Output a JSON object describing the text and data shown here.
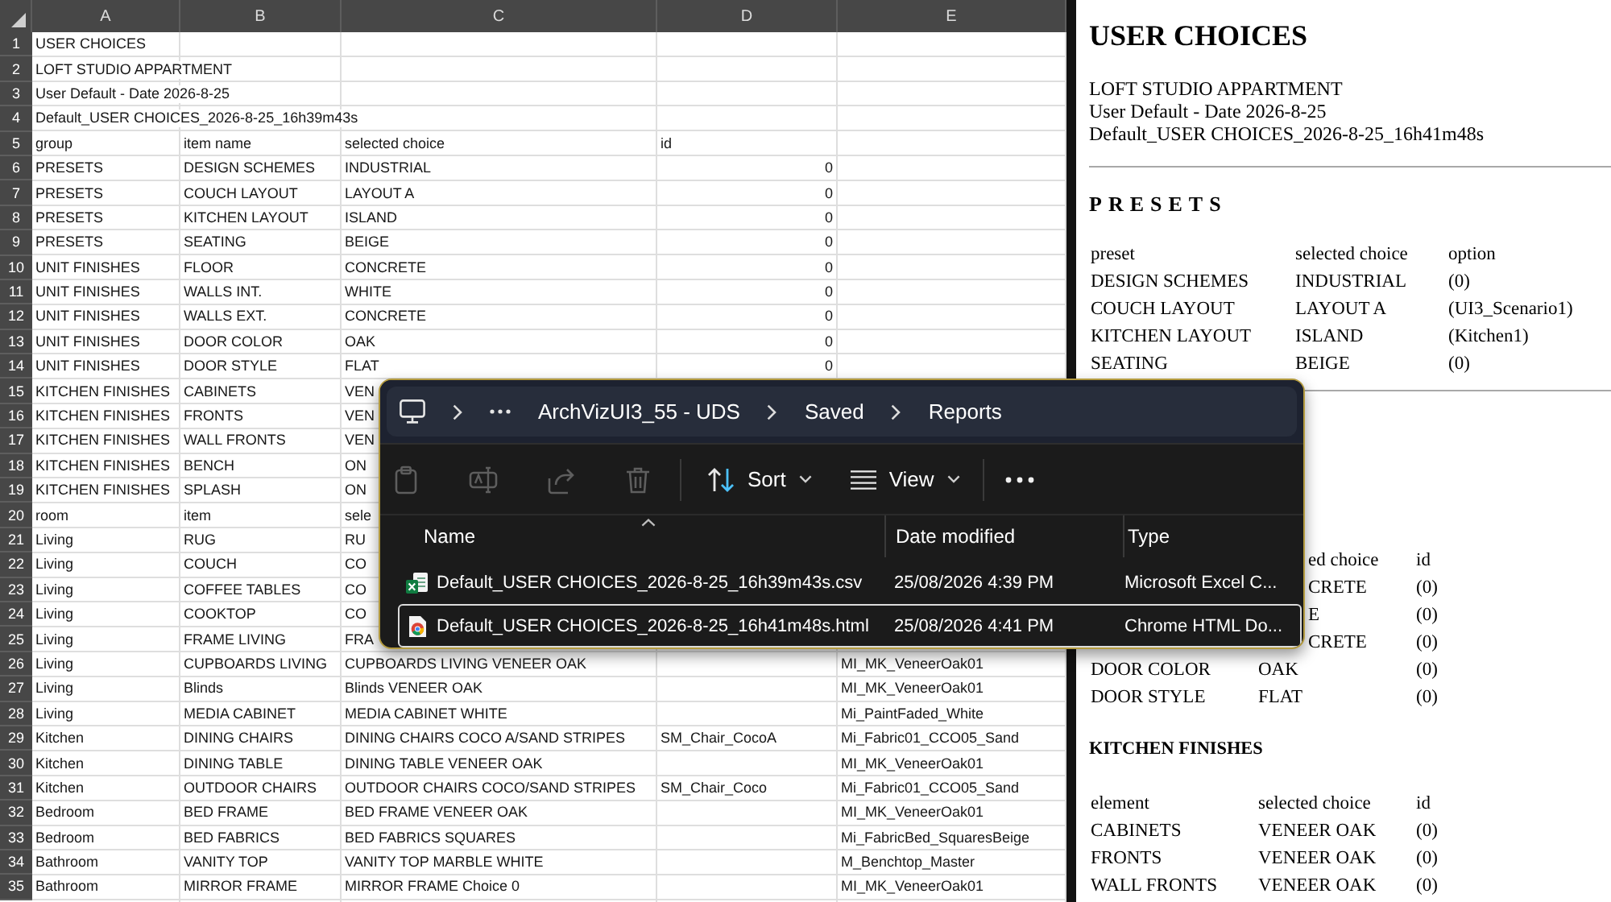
{
  "spreadsheet": {
    "columns": [
      "A",
      "B",
      "C",
      "D",
      "E"
    ],
    "rows": [
      {
        "number": "1",
        "cells": {
          "A": "USER CHOICES"
        }
      },
      {
        "number": "2",
        "cells": {
          "A": "LOFT STUDIO APPARTMENT"
        }
      },
      {
        "number": "3",
        "cells": {
          "A": "User Default - Date 2026-8-25"
        }
      },
      {
        "number": "4",
        "cells": {
          "A": "Default_USER CHOICES_2026-8-25_16h39m43s"
        }
      },
      {
        "number": "5",
        "cells": {
          "A": "group",
          "B": "item name",
          "C": "selected choice",
          "D": "id"
        }
      },
      {
        "number": "6",
        "cells": {
          "A": "PRESETS",
          "B": "DESIGN SCHEMES",
          "C": "INDUSTRIAL"
        },
        "numbers": {
          "D": "0"
        }
      },
      {
        "number": "7",
        "cells": {
          "A": "PRESETS",
          "B": "COUCH LAYOUT",
          "C": "LAYOUT A"
        },
        "numbers": {
          "D": "0"
        }
      },
      {
        "number": "8",
        "cells": {
          "A": "PRESETS",
          "B": "KITCHEN LAYOUT",
          "C": "ISLAND"
        },
        "numbers": {
          "D": "0"
        }
      },
      {
        "number": "9",
        "cells": {
          "A": "PRESETS",
          "B": "SEATING",
          "C": "BEIGE"
        },
        "numbers": {
          "D": "0"
        }
      },
      {
        "number": "10",
        "cells": {
          "A": "UNIT FINISHES",
          "B": "FLOOR",
          "C": "CONCRETE"
        },
        "numbers": {
          "D": "0"
        }
      },
      {
        "number": "11",
        "cells": {
          "A": "UNIT FINISHES",
          "B": "WALLS INT.",
          "C": "WHITE"
        },
        "numbers": {
          "D": "0"
        }
      },
      {
        "number": "12",
        "cells": {
          "A": "UNIT FINISHES",
          "B": "WALLS EXT.",
          "C": "CONCRETE"
        },
        "numbers": {
          "D": "0"
        }
      },
      {
        "number": "13",
        "cells": {
          "A": "UNIT FINISHES",
          "B": "DOOR COLOR",
          "C": "OAK"
        },
        "numbers": {
          "D": "0"
        }
      },
      {
        "number": "14",
        "cells": {
          "A": "UNIT FINISHES",
          "B": "DOOR STYLE",
          "C": "FLAT"
        },
        "numbers": {
          "D": "0"
        }
      },
      {
        "number": "15",
        "cells": {
          "A": "KITCHEN FINISHES",
          "B": "CABINETS",
          "C": "VEN"
        }
      },
      {
        "number": "16",
        "cells": {
          "A": "KITCHEN FINISHES",
          "B": "FRONTS",
          "C": "VEN"
        }
      },
      {
        "number": "17",
        "cells": {
          "A": "KITCHEN FINISHES",
          "B": "WALL FRONTS",
          "C": "VEN"
        }
      },
      {
        "number": "18",
        "cells": {
          "A": "KITCHEN FINISHES",
          "B": "BENCH",
          "C": "ON"
        }
      },
      {
        "number": "19",
        "cells": {
          "A": "KITCHEN FINISHES",
          "B": "SPLASH",
          "C": "ON"
        }
      },
      {
        "number": "20",
        "cells": {
          "A": "room",
          "B": "item",
          "C": "sele"
        }
      },
      {
        "number": "21",
        "cells": {
          "A": "Living",
          "B": "RUG",
          "C": "RU"
        }
      },
      {
        "number": "22",
        "cells": {
          "A": "Living",
          "B": "COUCH",
          "C": "CO"
        }
      },
      {
        "number": "23",
        "cells": {
          "A": "Living",
          "B": "COFFEE TABLES",
          "C": "CO"
        }
      },
      {
        "number": "24",
        "cells": {
          "A": "Living",
          "B": "COOKTOP",
          "C": "CO"
        }
      },
      {
        "number": "25",
        "cells": {
          "A": "Living",
          "B": "FRAME LIVING",
          "C": "FRA"
        }
      },
      {
        "number": "26",
        "cells": {
          "A": "Living",
          "B": "CUPBOARDS LIVING",
          "C": "CUPBOARDS LIVING VENEER OAK",
          "E": "MI_MK_VeneerOak01"
        }
      },
      {
        "number": "27",
        "cells": {
          "A": "Living",
          "B": "Blinds",
          "C": "Blinds VENEER OAK",
          "E": "MI_MK_VeneerOak01"
        }
      },
      {
        "number": "28",
        "cells": {
          "A": "Living",
          "B": "MEDIA CABINET",
          "C": "MEDIA CABINET WHITE",
          "E": "Mi_PaintFaded_White"
        }
      },
      {
        "number": "29",
        "cells": {
          "A": "Kitchen",
          "B": "DINING CHAIRS",
          "C": "DINING CHAIRS COCO A/SAND STRIPES",
          "D": "SM_Chair_CocoA",
          "E": "Mi_Fabric01_CCO05_Sand"
        }
      },
      {
        "number": "30",
        "cells": {
          "A": "Kitchen",
          "B": "DINING TABLE",
          "C": "DINING TABLE VENEER OAK",
          "E": "MI_MK_VeneerOak01"
        }
      },
      {
        "number": "31",
        "cells": {
          "A": "Kitchen",
          "B": "OUTDOOR CHAIRS",
          "C": "OUTDOOR CHAIRS COCO/SAND STRIPES",
          "D": "SM_Chair_Coco",
          "E": "Mi_Fabric01_CCO05_Sand"
        }
      },
      {
        "number": "32",
        "cells": {
          "A": "Bedroom",
          "B": "BED FRAME",
          "C": "BED FRAME VENEER OAK",
          "E": "MI_MK_VeneerOak01"
        }
      },
      {
        "number": "33",
        "cells": {
          "A": "Bedroom",
          "B": "BED FABRICS",
          "C": "BED FABRICS SQUARES",
          "E": "Mi_FabricBed_SquaresBeige"
        }
      },
      {
        "number": "34",
        "cells": {
          "A": "Bathroom",
          "B": "VANITY TOP",
          "C": "VANITY TOP MARBLE WHITE",
          "E": "M_Benchtop_Master"
        }
      },
      {
        "number": "35",
        "cells": {
          "A": "Bathroom",
          "B": "MIRROR FRAME",
          "C": "MIRROR FRAME Choice 0",
          "E": "MI_MK_VeneerOak01"
        }
      }
    ]
  },
  "report": {
    "title": "USER CHOICES",
    "lines": [
      "LOFT STUDIO APPARTMENT",
      "User Default - Date 2026-8-25",
      "Default_USER CHOICES_2026-8-25_16h41m48s"
    ],
    "sections": [
      {
        "kind": "preset",
        "heading": "PRESETS",
        "columns": {
          "preset": "preset",
          "selected_choice": "selected choice",
          "option": "option"
        },
        "rows": [
          {
            "preset": "DESIGN SCHEMES",
            "selected_choice": "INDUSTRIAL",
            "option": "(0)"
          },
          {
            "preset": "COUCH LAYOUT",
            "selected_choice": "LAYOUT A",
            "option": "(UI3_Scenario1)"
          },
          {
            "preset": "KITCHEN LAYOUT",
            "selected_choice": "ISLAND",
            "option": "(Kitchen1)"
          },
          {
            "preset": "SEATING",
            "selected_choice": "BEIGE",
            "option": "(0)"
          }
        ]
      },
      {
        "kind": "finish",
        "columns": {
          "selected_choice": "ed choice",
          "id": "id"
        },
        "rows": [
          {
            "selected_choice": "CRETE",
            "id": "(0)"
          },
          {
            "selected_choice": "E",
            "id": "(0)"
          },
          {
            "selected_choice": "CRETE",
            "id": "(0)"
          },
          {
            "element": "DOOR COLOR",
            "selected_choice": "OAK",
            "id": "(0)"
          },
          {
            "element": "DOOR STYLE",
            "selected_choice": "FLAT",
            "id": "(0)"
          }
        ]
      },
      {
        "kind": "finish",
        "heading": "KITCHEN FINISHES",
        "columns": {
          "element": "element",
          "selected_choice": "selected choice",
          "id": "id"
        },
        "rows": [
          {
            "element": "CABINETS",
            "selected_choice": "VENEER OAK",
            "id": "(0)"
          },
          {
            "element": "FRONTS",
            "selected_choice": "VENEER OAK",
            "id": "(0)"
          },
          {
            "element": "WALL FRONTS",
            "selected_choice": "VENEER OAK",
            "id": "(0)"
          }
        ]
      }
    ]
  },
  "explorer": {
    "breadcrumb": [
      "ArchVizUI3_55 - UDS",
      "Saved",
      "Reports"
    ],
    "toolbar": {
      "actions": [
        {
          "disabled": true
        },
        {
          "disabled": true
        },
        {
          "disabled": true
        },
        {
          "disabled": true
        }
      ],
      "sort": {
        "label": "Sort"
      },
      "view": {
        "label": "View"
      }
    },
    "columns": [
      {
        "label": "Name",
        "sorted": true
      },
      {
        "label": "Date modified",
        "sorted": false
      },
      {
        "label": "Type",
        "sorted": false
      }
    ],
    "files": [
      {
        "kind": "csv",
        "name": "Default_USER CHOICES_2026-8-25_16h39m43s.csv",
        "date": "25/08/2026 4:39 PM",
        "type": "Microsoft Excel C...",
        "selected": false
      },
      {
        "kind": "html",
        "name": "Default_USER CHOICES_2026-8-25_16h41m48s.html",
        "date": "25/08/2026 4:41 PM",
        "type": "Chrome HTML Do...",
        "selected": true
      }
    ]
  }
}
